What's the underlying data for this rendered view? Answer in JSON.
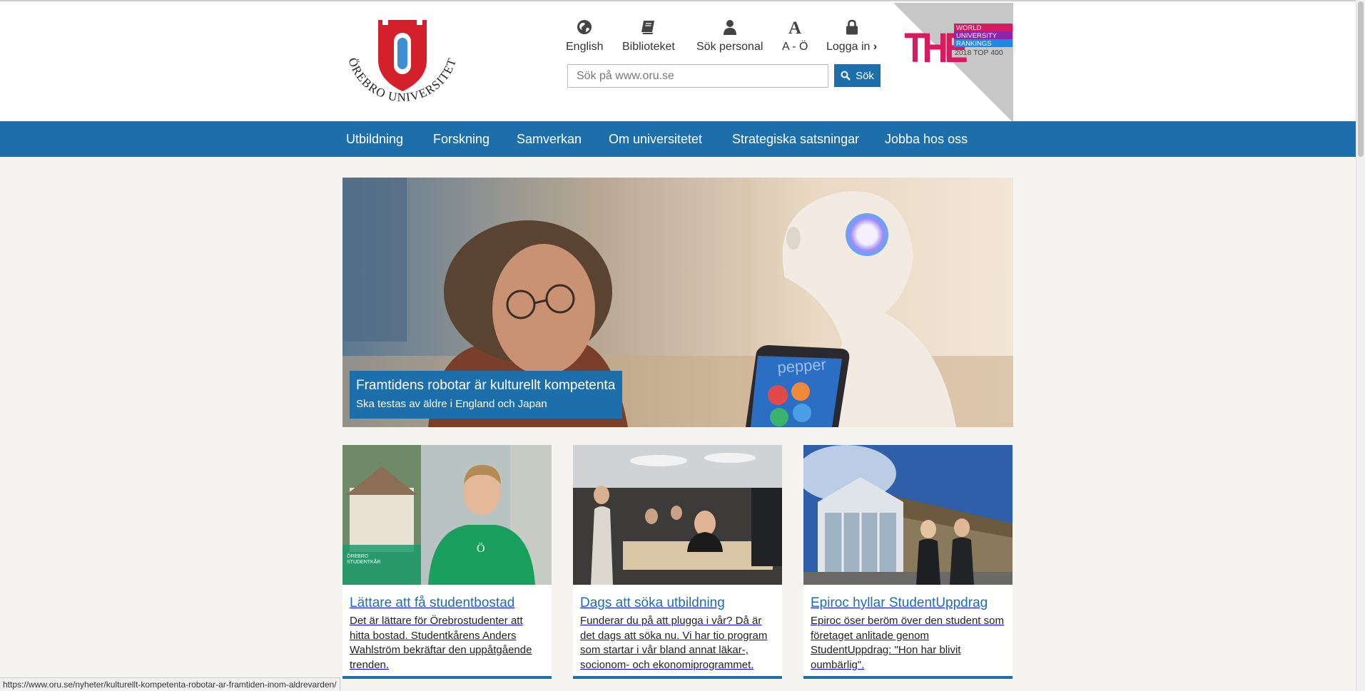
{
  "header": {
    "logo_text": "ÖREBRO UNIVERSITET",
    "utility": [
      {
        "label": "English",
        "icon": "globe-icon"
      },
      {
        "label": "Biblioteket",
        "icon": "book-icon"
      },
      {
        "label": "Sök personal",
        "icon": "person-icon"
      },
      {
        "label": "A - Ö",
        "icon": "letter-a-icon"
      },
      {
        "label": "Logga in",
        "icon": "lock-icon"
      }
    ],
    "search": {
      "placeholder": "Sök på www.oru.se",
      "button_label": "Sök"
    },
    "ranking_badge": {
      "mark": "THE",
      "lines": [
        "WORLD",
        "UNIVERSITY",
        "RANKINGS",
        "2018 TOP 400"
      ]
    }
  },
  "nav": {
    "items": [
      "Utbildning",
      "Forskning",
      "Samverkan",
      "Om universitetet",
      "Strategiska satsningar",
      "Jobba hos oss"
    ]
  },
  "hero": {
    "title": "Framtidens robotar är kulturellt kompetenta",
    "subtitle": "Ska testas av äldre i England och Japan",
    "tablet_text": "pepper"
  },
  "cards": [
    {
      "title": "Lättare att få studentbostad",
      "text": "Det är lättare för Örebrostudenter att hitta bostad. Studentkårens Anders Wahlström bekräftar den uppåtgående trenden."
    },
    {
      "title": "Dags att söka utbildning",
      "text": "Funderar du på att plugga i vår? Då är det dags att söka nu. Vi har tio program som startar i vår bland annat läkar-, socionom- och ekonomiprogrammet."
    },
    {
      "title": "Epiroc hyllar StudentUppdrag",
      "text": "Epiroc öser beröm över den student som företaget anlitade genom StudentUppdrag: \"Hon har blivit oumbärlig\"."
    }
  ],
  "status_url": "https://www.oru.se/nyheter/kulturellt-kompetenta-robotar-ar-framtiden-inom-aldrevarden/",
  "colors": {
    "brand_blue": "#1c6fab",
    "logo_red": "#d4202a",
    "page_bg": "#f5f4f1"
  }
}
